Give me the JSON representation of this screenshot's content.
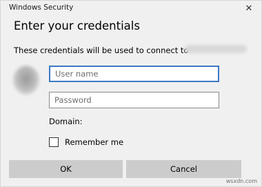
{
  "window": {
    "title": "Windows Security",
    "close_icon": "close-icon"
  },
  "dialog": {
    "heading": "Enter your credentials",
    "subtext": "These credentials will be used to connect to"
  },
  "form": {
    "username_placeholder": "User name",
    "password_placeholder": "Password",
    "domain_label": "Domain:",
    "remember_label": "Remember me",
    "remember_checked": false
  },
  "buttons": {
    "ok": "OK",
    "cancel": "Cancel"
  },
  "watermark": "wsxdn.com",
  "colors": {
    "dialog_bg": "#f0f0f0",
    "focus_border": "#3b78c4",
    "button_bg": "#cccccc"
  }
}
